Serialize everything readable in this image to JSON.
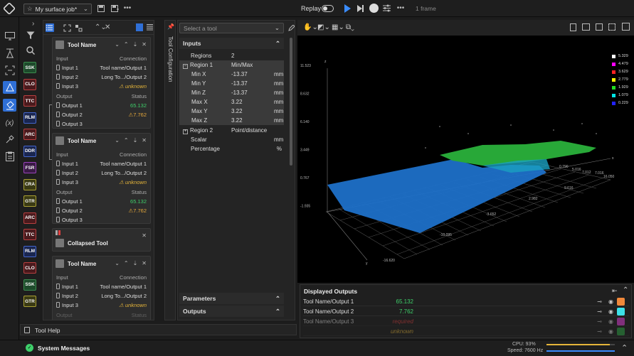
{
  "topbar": {
    "job_name": "My surface job*",
    "replay_label": "Replay",
    "frame_label": "1 frame"
  },
  "palette": [
    {
      "label": "SSK",
      "style": "green"
    },
    {
      "label": "CLO",
      "style": "red"
    },
    {
      "label": "TTC",
      "style": "red"
    },
    {
      "label": "RLM",
      "style": "blue"
    },
    {
      "label": "ARC",
      "style": "red"
    },
    {
      "label": "DDR",
      "style": "blue"
    },
    {
      "label": "FSR",
      "style": "purple"
    },
    {
      "label": "CRA",
      "style": "olive"
    },
    {
      "label": "GTR",
      "style": "olive"
    },
    {
      "label": "ARC",
      "style": "red"
    },
    {
      "label": "TTC",
      "style": "red"
    },
    {
      "label": "RLM",
      "style": "blue"
    },
    {
      "label": "CLO",
      "style": "red"
    },
    {
      "label": "SSK",
      "style": "green"
    },
    {
      "label": "GTR",
      "style": "olive"
    }
  ],
  "tools": {
    "card1": {
      "title": "Tool Name",
      "input_hdr": "Input",
      "conn_hdr": "Connection",
      "in1": "Input 1",
      "in1v": "Tool name/Output 1",
      "in2": "Input 2",
      "in2v": "Long To.../Output 2",
      "in3": "Input 3",
      "in3v": "unknown",
      "out_hdr": "Output",
      "status_hdr": "Status",
      "out1": "Output 1",
      "out1v": "65.132",
      "out2": "Output 2",
      "out2v": "7.762",
      "out3": "Output 3"
    },
    "card2": {
      "title": "Tool Name",
      "input_hdr": "Input",
      "conn_hdr": "Connection",
      "in1": "Input 1",
      "in1v": "Tool name/Output 1",
      "in2": "Input 2",
      "in2v": "Long To.../Output 2",
      "in3": "Input 3",
      "in3v": "unknown",
      "out_hdr": "Output",
      "status_hdr": "Status",
      "out1": "Output 1",
      "out1v": "65.132",
      "out2": "Output 2",
      "out2v": "7.762",
      "out3": "Output 3"
    },
    "collapsed_title": "Collapsed Tool",
    "card4": {
      "title": "Tool Name",
      "input_hdr": "Input",
      "conn_hdr": "Connection",
      "in1": "Input 1",
      "in1v": "Tool name/Output 1",
      "in2": "Input 2",
      "in2v": "Long To.../Output 2",
      "in3": "Input 3",
      "in3v": "unknown",
      "out_hdr": "Output",
      "status_hdr": "Status"
    }
  },
  "config": {
    "strip_label": "Tool Configuration",
    "select_placeholder": "Select a tool",
    "inputs_label": "Inputs",
    "rows": {
      "regions_k": "Regions",
      "regions_v": "2",
      "region1_k": "Region 1",
      "region1_v": "Min/Max",
      "minx_k": "Min X",
      "minx_v": "-13.37",
      "minx_u": "mm",
      "miny_k": "Min Y",
      "miny_v": "-13.37",
      "miny_u": "mm",
      "minz_k": "Min Z",
      "minz_v": "-13.37",
      "minz_u": "mm",
      "maxx_k": "Max X",
      "maxx_v": "3.22",
      "maxx_u": "mm",
      "maxy_k": "Max Y",
      "maxy_v": "3.22",
      "maxy_u": "mm",
      "maxz_k": "Max Z",
      "maxz_v": "3.22",
      "maxz_u": "mm",
      "region2_k": "Region 2",
      "region2_v": "Point/distance",
      "scalar_k": "Scalar",
      "scalar_u": "mm",
      "pct_k": "Percentage",
      "pct_u": "%"
    },
    "parameters_label": "Parameters",
    "outputs_label": "Outputs"
  },
  "viewer": {
    "legend": [
      {
        "label": "5.329",
        "color": "#ffffff"
      },
      {
        "label": "4.479",
        "color": "#ff00ff"
      },
      {
        "label": "3.629",
        "color": "#ff2222"
      },
      {
        "label": "2.779",
        "color": "#ffff00"
      },
      {
        "label": "1.929",
        "color": "#22dd22"
      },
      {
        "label": "1.079",
        "color": "#00e5e5"
      },
      {
        "label": "0.229",
        "color": "#2222ff"
      }
    ],
    "z_ticks": [
      "11.523",
      "8.632",
      "6.140",
      "3.449",
      "0.767",
      "-1.935"
    ],
    "y_ticks": [
      "-16.620",
      "-10.095",
      "-3.652",
      "2.982",
      "9.616",
      "16.050"
    ],
    "x_ticks": [
      "0.790",
      "5.016",
      "7.012",
      "7.016"
    ],
    "axis_z": "z",
    "axis_y": "y",
    "axis_x": "x"
  },
  "outputs_panel": {
    "title": "Displayed Outputs",
    "rows": [
      {
        "name": "Tool Name/Output 1",
        "value": "65.132",
        "color": "#f0883a"
      },
      {
        "name": "Tool Name/Output 2",
        "value": "7.762",
        "color": "#3de0e8"
      },
      {
        "name": "Tool Name/Output 3",
        "value": "required",
        "color": "#e040d8"
      },
      {
        "name": "",
        "value": "unknown",
        "color": "#2ea043"
      }
    ]
  },
  "help_label": "Tool Help",
  "status": {
    "messages_label": "System Messages",
    "cpu": "CPU: 93%",
    "speed": "Speed: 7600 Hz",
    "cpu_fraction": 0.93
  }
}
